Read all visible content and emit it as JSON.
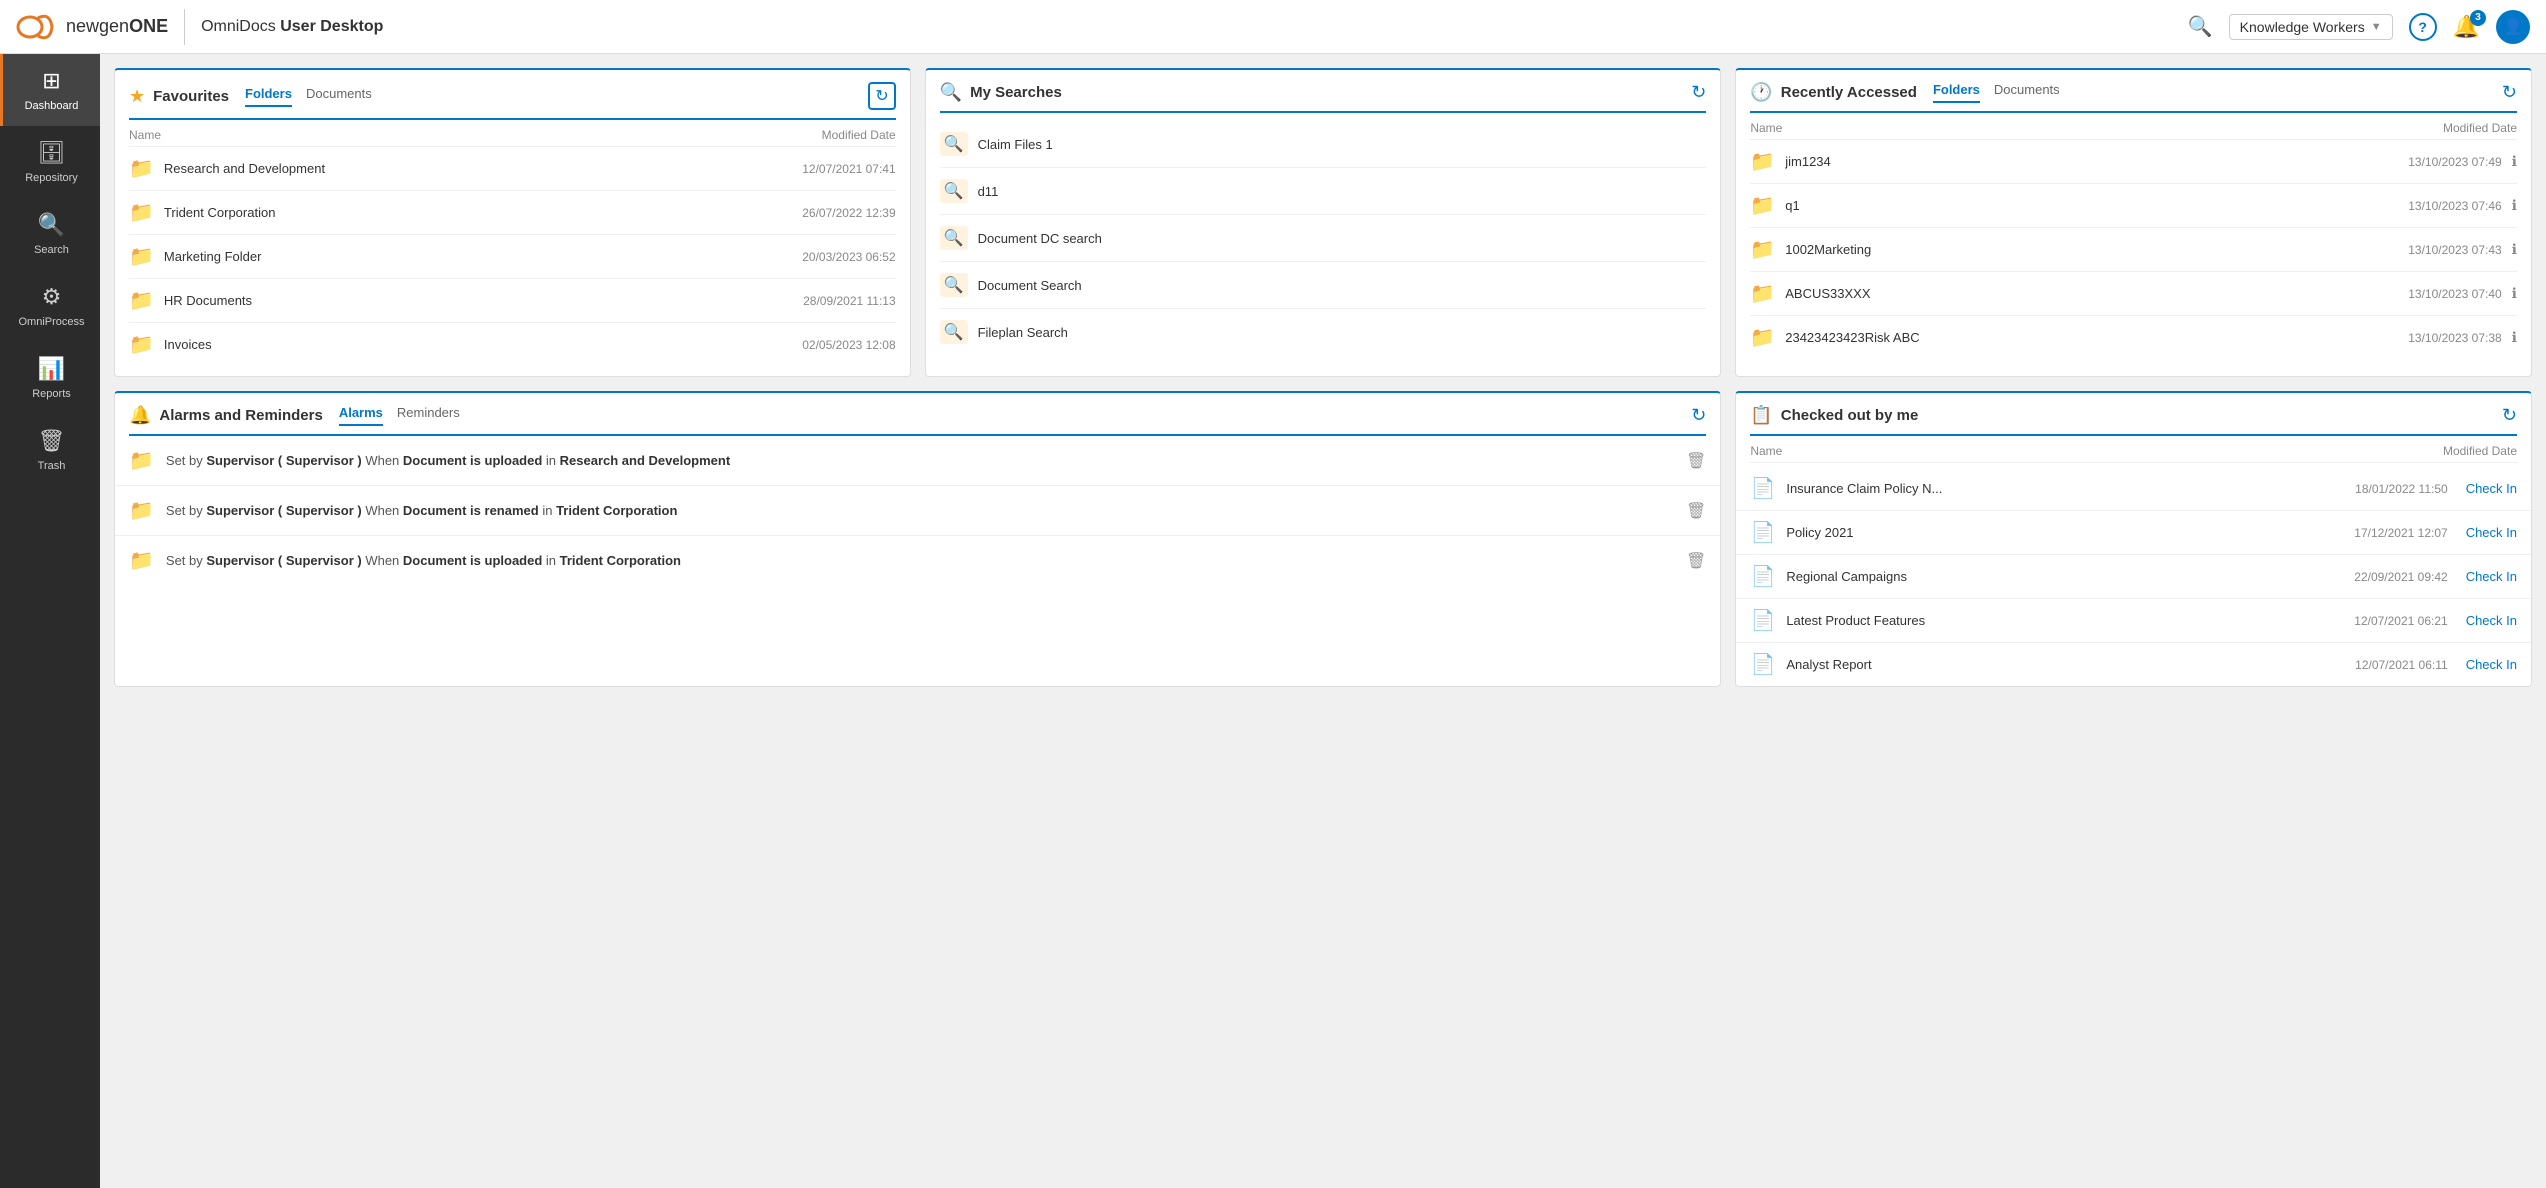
{
  "topnav": {
    "logo_text1": "newgen",
    "logo_text2": "ONE",
    "app_name": "OmniDocs",
    "app_subtitle": "User Desktop",
    "user_label": "Knowledge Workers",
    "help_label": "?",
    "notif_count": "3"
  },
  "sidebar": {
    "items": [
      {
        "id": "dashboard",
        "label": "Dashboard",
        "icon": "⊞",
        "active": true
      },
      {
        "id": "repository",
        "label": "Repository",
        "icon": "🗄",
        "active": false
      },
      {
        "id": "search",
        "label": "Search",
        "icon": "🔍",
        "active": false
      },
      {
        "id": "omniprocess",
        "label": "OmniProcess",
        "icon": "⚙",
        "active": false
      },
      {
        "id": "reports",
        "label": "Reports",
        "icon": "📊",
        "active": false
      },
      {
        "id": "trash",
        "label": "Trash",
        "icon": "🗑",
        "active": false
      }
    ]
  },
  "favourites": {
    "title": "Favourites",
    "tab_folders": "Folders",
    "tab_documents": "Documents",
    "col_name": "Name",
    "col_date": "Modified Date",
    "items": [
      {
        "name": "Research and Development",
        "date": "12/07/2021 07:41"
      },
      {
        "name": "Trident Corporation",
        "date": "26/07/2022 12:39"
      },
      {
        "name": "Marketing Folder",
        "date": "20/03/2023 06:52"
      },
      {
        "name": "HR Documents",
        "date": "28/09/2021 11:13"
      },
      {
        "name": "Invoices",
        "date": "02/05/2023 12:08"
      }
    ]
  },
  "my_searches": {
    "title": "My Searches",
    "items": [
      {
        "label": "Claim Files 1"
      },
      {
        "label": "d11"
      },
      {
        "label": "Document DC search"
      },
      {
        "label": "Document Search"
      },
      {
        "label": "Fileplan Search"
      }
    ]
  },
  "recently_accessed": {
    "title": "Recently Accessed",
    "tab_folders": "Folders",
    "tab_documents": "Documents",
    "col_name": "Name",
    "col_date": "Modified Date",
    "items": [
      {
        "name": "jim1234",
        "date": "13/10/2023 07:49"
      },
      {
        "name": "q1",
        "date": "13/10/2023 07:46"
      },
      {
        "name": "1002Marketing",
        "date": "13/10/2023 07:43"
      },
      {
        "name": "ABCUS33XXX",
        "date": "13/10/2023 07:40"
      },
      {
        "name": "23423423423Risk ABC",
        "date": "13/10/2023 07:38"
      }
    ]
  },
  "alarms": {
    "title": "Alarms and Reminders",
    "tab_alarms": "Alarms",
    "tab_reminders": "Reminders",
    "items": [
      {
        "text": "Set by Supervisor ( Supervisor ) When Document is uploaded in Research and Development"
      },
      {
        "text": "Set by Supervisor ( Supervisor ) When Document is renamed in Trident Corporation"
      },
      {
        "text": "Set by Supervisor ( Supervisor ) When Document is uploaded in Trident Corporation"
      }
    ]
  },
  "checked_out": {
    "title": "Checked out by me",
    "col_name": "Name",
    "col_date": "Modified Date",
    "checkin_label": "Check In",
    "items": [
      {
        "name": "Insurance Claim Policy N...",
        "date": "18/01/2022 11:50",
        "icon_type": "doc-gray"
      },
      {
        "name": "Policy 2021",
        "date": "17/12/2021 12:07",
        "icon_type": "doc-red"
      },
      {
        "name": "Regional Campaigns",
        "date": "22/09/2021 09:42",
        "icon_type": "doc-green"
      },
      {
        "name": "Latest Product Features",
        "date": "12/07/2021 06:21",
        "icon_type": "doc-gray"
      },
      {
        "name": "Analyst Report",
        "date": "12/07/2021 06:11",
        "icon_type": "doc-gray"
      }
    ]
  }
}
